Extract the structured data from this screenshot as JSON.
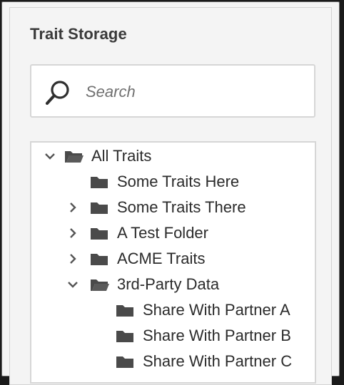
{
  "panel": {
    "title": "Trait Storage"
  },
  "search": {
    "placeholder": "Search",
    "value": ""
  },
  "tree": {
    "items": [
      {
        "label": "All Traits",
        "expanded": true,
        "icon": "folder-open-icon"
      },
      {
        "label": "Some Traits Here",
        "icon": "folder-icon"
      },
      {
        "label": "Some Traits There",
        "icon": "folder-icon",
        "expanded": false
      },
      {
        "label": "A Test Folder",
        "icon": "folder-icon",
        "expanded": false
      },
      {
        "label": "ACME Traits",
        "icon": "folder-icon",
        "expanded": false
      },
      {
        "label": "3rd-Party Data",
        "icon": "folder-open-icon",
        "expanded": true
      },
      {
        "label": "Share With Partner A",
        "icon": "folder-icon"
      },
      {
        "label": "Share With Partner B",
        "icon": "folder-icon"
      },
      {
        "label": "Share With Partner C",
        "icon": "folder-icon"
      }
    ]
  }
}
